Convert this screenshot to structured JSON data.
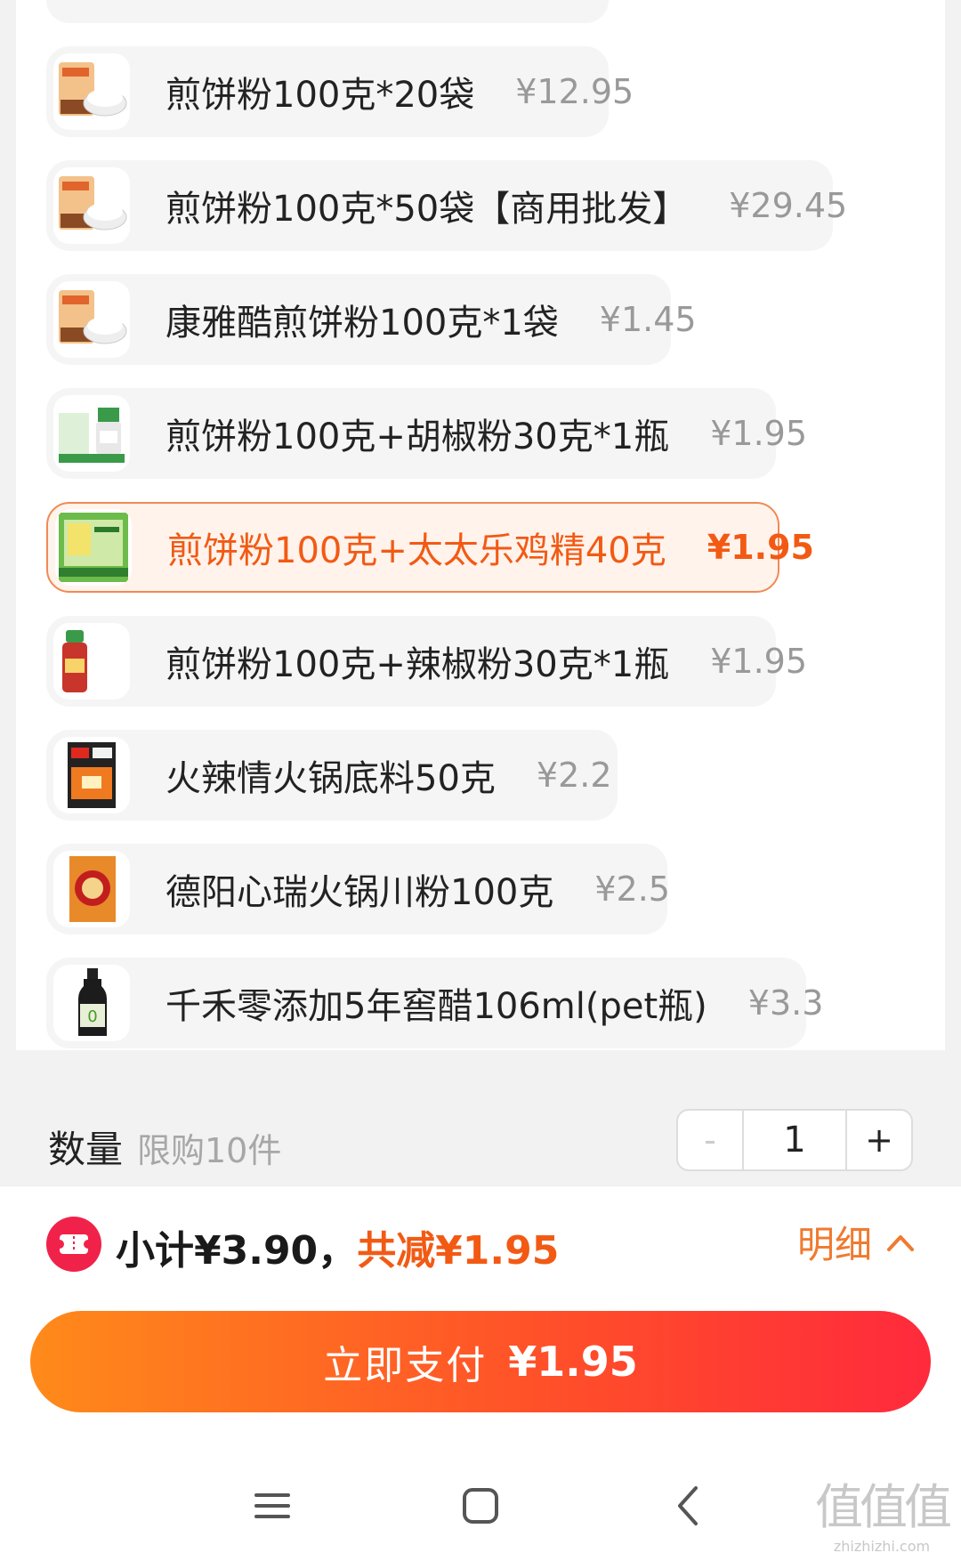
{
  "options": [
    {
      "name": "煎饼粉100克*20袋",
      "price": "¥12.95",
      "thumb": "flour-pack"
    },
    {
      "name": "煎饼粉100克*50袋【商用批发】",
      "price": "¥29.45",
      "thumb": "flour-pack"
    },
    {
      "name": "康雅酷煎饼粉100克*1袋",
      "price": "¥1.45",
      "thumb": "flour-pack"
    },
    {
      "name": "煎饼粉100克+胡椒粉30克*1瓶",
      "price": "¥1.95",
      "thumb": "pepper-bottle"
    },
    {
      "name": "煎饼粉100克+太太乐鸡精40克",
      "price": "¥1.95",
      "thumb": "chicken-essence",
      "selected": true
    },
    {
      "name": "煎饼粉100克+辣椒粉30克*1瓶",
      "price": "¥1.95",
      "thumb": "chili-bottle"
    },
    {
      "name": "火辣情火锅底料50克",
      "price": "¥2.2",
      "thumb": "hotpot-base"
    },
    {
      "name": "德阳心瑞火锅川粉100克",
      "price": "¥2.5",
      "thumb": "noodle-pack"
    },
    {
      "name": "千禾零添加5年窖醋106ml(pet瓶)",
      "price": "¥3.3",
      "thumb": "vinegar-bottle"
    }
  ],
  "quantity": {
    "label": "数量",
    "limit": "限购10件",
    "minus": "-",
    "value": "1",
    "plus": "+"
  },
  "summary": {
    "subtotal": "小计¥3.90，",
    "discount": "共减¥1.95",
    "detail": "明细"
  },
  "pay": {
    "label": "立即支付",
    "amount": "¥1.95"
  },
  "watermark": {
    "big": "值值值",
    "small": "zhizhizhi.com"
  },
  "colors": {
    "accent": "#f25a14",
    "pay_gradient_start": "#ff8a1a",
    "pay_gradient_end": "#ff2a3c"
  }
}
